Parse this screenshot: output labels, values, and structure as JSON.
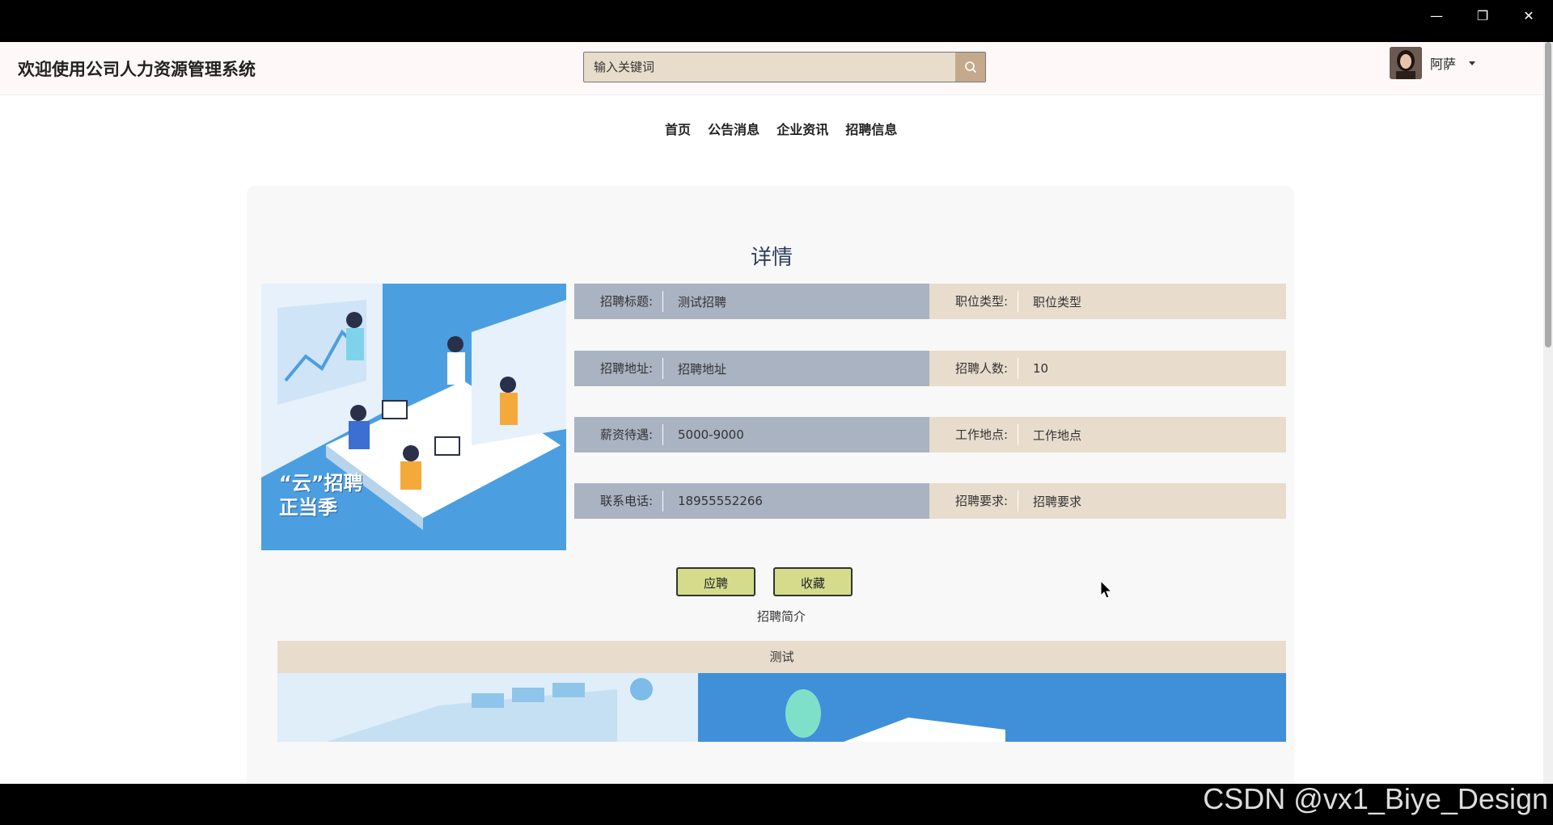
{
  "window": {
    "minimize_glyph": "—",
    "restore_glyph": "❐",
    "close_glyph": "✕"
  },
  "header": {
    "site_title": "欢迎使用公司人力资源管理系统",
    "search_placeholder": "输入关键词",
    "search_icon": "search-icon",
    "user_name": "阿萨"
  },
  "nav": {
    "items": [
      {
        "label": "首页"
      },
      {
        "label": "公告消息"
      },
      {
        "label": "企业资讯"
      },
      {
        "label": "招聘信息"
      }
    ]
  },
  "detail": {
    "title": "详情",
    "image_caption_line1": "“云”招聘",
    "image_caption_line2": "正当季",
    "fields": [
      {
        "label": "招聘标题:",
        "value": "测试招聘",
        "label2": "职位类型:",
        "value2": "职位类型"
      },
      {
        "label": "招聘地址:",
        "value": "招聘地址",
        "label2": "招聘人数:",
        "value2": "10"
      },
      {
        "label": "薪资待遇:",
        "value": "5000-9000",
        "label2": "工作地点:",
        "value2": "工作地点"
      },
      {
        "label": "联系电话:",
        "value": "18955552266",
        "label2": "招聘要求:",
        "value2": "招聘要求"
      }
    ],
    "apply_label": "应聘",
    "favorite_label": "收藏",
    "intro_label": "招聘简介",
    "intro_text": "测试"
  },
  "footer": {
    "watermark": "CSDN @vx1_Biye_Design"
  },
  "colors": {
    "left_cell": "#a9b3c2",
    "right_cell": "#e8dccd",
    "button": "#d4dc8c",
    "search_bg": "#e8dccb"
  }
}
